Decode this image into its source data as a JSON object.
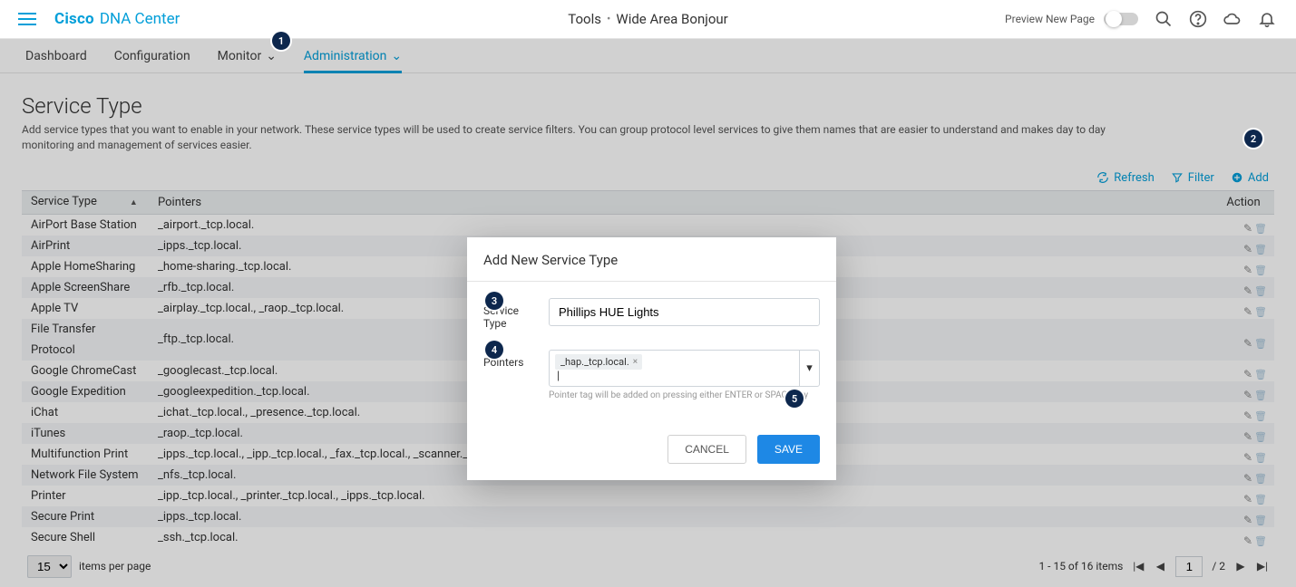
{
  "header": {
    "brand_cisco": "Cisco",
    "brand_dna": "DNA Center",
    "tools_label": "Tools",
    "separator": "•",
    "subtitle": "Wide Area Bonjour",
    "preview_label": "Preview New Page"
  },
  "tabs": [
    {
      "label": "Dashboard",
      "dropdown": false
    },
    {
      "label": "Configuration",
      "dropdown": false
    },
    {
      "label": "Monitor",
      "dropdown": true
    },
    {
      "label": "Administration",
      "dropdown": true
    }
  ],
  "page": {
    "title": "Service Type",
    "description": "Add service types that you want to enable in your network. These service types will be used to create service filters. You can group protocol level services to give them names that are easier to understand and makes day to day monitoring and management of services easier."
  },
  "toolbar": {
    "refresh": "Refresh",
    "filter": "Filter",
    "add": "Add"
  },
  "columns": {
    "service_type": "Service Type",
    "pointers": "Pointers",
    "action": "Action"
  },
  "rows": [
    {
      "name": "AirPort Base Station",
      "pointers": "_airport._tcp.local."
    },
    {
      "name": "AirPrint",
      "pointers": "_ipps._tcp.local."
    },
    {
      "name": "Apple HomeSharing",
      "pointers": "_home-sharing._tcp.local."
    },
    {
      "name": "Apple ScreenShare",
      "pointers": "_rfb._tcp.local."
    },
    {
      "name": "Apple TV",
      "pointers": "_airplay._tcp.local., _raop._tcp.local."
    },
    {
      "name": "File Transfer Protocol",
      "pointers": "_ftp._tcp.local."
    },
    {
      "name": "Google ChromeCast",
      "pointers": "_googlecast._tcp.local."
    },
    {
      "name": "Google Expedition",
      "pointers": "_googleexpedition._tcp.local."
    },
    {
      "name": "iChat",
      "pointers": "_ichat._tcp.local., _presence._tcp.local."
    },
    {
      "name": "iTunes",
      "pointers": "_raop._tcp.local."
    },
    {
      "name": "Multifunction Print",
      "pointers": "_ipps._tcp.local., _ipp._tcp.local., _fax._tcp.local., _scanner._tcp.local., _printer._tcp.local."
    },
    {
      "name": "Network File System",
      "pointers": "_nfs._tcp.local."
    },
    {
      "name": "Printer",
      "pointers": "_ipp._tcp.local., _printer._tcp.local., _ipps._tcp.local."
    },
    {
      "name": "Secure Print",
      "pointers": "_ipps._tcp.local."
    },
    {
      "name": "Secure Shell",
      "pointers": "_ssh._tcp.local."
    }
  ],
  "pagination": {
    "per_page_value": "15",
    "per_page_label": "items per page",
    "range_text": "1 - 15 of 16 items",
    "current_page": "1",
    "total_pages": "2"
  },
  "dialog": {
    "title": "Add New Service Type",
    "service_type_label": "Service Type",
    "service_type_value": "Phillips HUE Lights",
    "pointers_label": "Pointers",
    "pointer_tag": "_hap._tcp.local.",
    "hint": "Pointer tag will be added on pressing either ENTER or SPACE key",
    "cancel": "CANCEL",
    "save": "SAVE"
  },
  "steps": {
    "s1": "1",
    "s2": "2",
    "s3": "3",
    "s4": "4",
    "s5": "5"
  }
}
